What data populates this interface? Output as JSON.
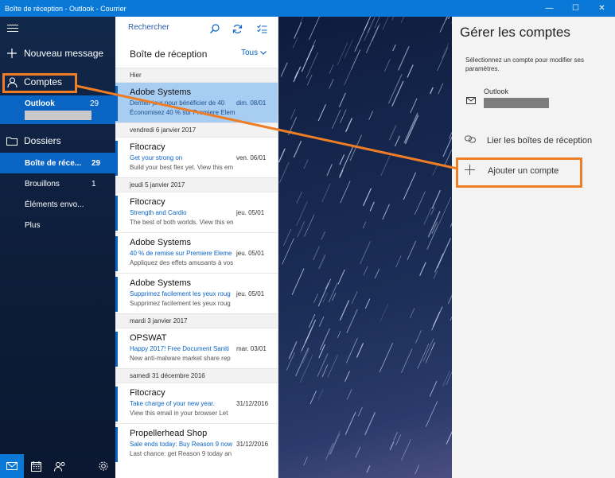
{
  "window": {
    "title": "Boîte de réception - Outlook - Courrier",
    "min": "—",
    "max": "☐",
    "close": "✕"
  },
  "nav": {
    "new_message": "Nouveau message",
    "accounts": "Comptes",
    "account": {
      "name": "Outlook",
      "count": "29"
    },
    "folders_label": "Dossiers",
    "folders": [
      {
        "name": "Boîte de réce...",
        "count": "29"
      },
      {
        "name": "Brouillons",
        "count": "1"
      },
      {
        "name": "Éléments envo...",
        "count": ""
      },
      {
        "name": "Plus",
        "count": ""
      }
    ]
  },
  "list": {
    "search_placeholder": "Rechercher",
    "title": "Boîte de réception",
    "filter": "Tous",
    "groups": [
      {
        "day": "Hier",
        "mails": [
          {
            "sender": "Adobe Systems",
            "subject": "Dernier jour pour bénéficier de 40",
            "date": "dim. 08/01",
            "preview": "Économisez 40 % sur Premiere Elem",
            "selected": true
          }
        ]
      },
      {
        "day": "vendredi 6 janvier 2017",
        "mails": [
          {
            "sender": "Fitocracy",
            "subject": "Get your strong on",
            "date": "ven. 06/01",
            "preview": "Build your best flex yet. View this em"
          }
        ]
      },
      {
        "day": "jeudi 5 janvier 2017",
        "mails": [
          {
            "sender": "Fitocracy",
            "subject": "Strength and Cardio",
            "date": "jeu. 05/01",
            "preview": "The best of both worlds. View this en"
          },
          {
            "sender": "Adobe Systems",
            "subject": "40 % de remise sur Premiere Eleme",
            "date": "jeu. 05/01",
            "preview": "Appliquez des effets amusants à vos"
          },
          {
            "sender": "Adobe Systems",
            "subject": "Supprimez facilement les yeux roug",
            "date": "jeu. 05/01",
            "preview": "Supprimez facilement les yeux roug"
          }
        ]
      },
      {
        "day": "mardi 3 janvier 2017",
        "mails": [
          {
            "sender": "OPSWAT",
            "subject": "Happy 2017! Free Document Saniti",
            "date": "mar. 03/01",
            "preview": "New anti-malware market share rep"
          }
        ]
      },
      {
        "day": "samedi 31 décembre 2016",
        "mails": [
          {
            "sender": "Fitocracy",
            "subject": "Take charge of your new year.",
            "date": "31/12/2016",
            "preview": "View this email in your browser Let"
          },
          {
            "sender": "Propellerhead Shop",
            "subject": "Sale ends today: Buy Reason 9 now",
            "date": "31/12/2016",
            "preview": "Last chance: get Reason 9 today an"
          }
        ]
      }
    ]
  },
  "panel": {
    "title": "Gérer les comptes",
    "description": "Sélectionnez un compte pour modifier ses paramètres.",
    "account_name": "Outlook",
    "link_inboxes": "Lier les boîtes de réception",
    "add_account": "Ajouter un compte"
  },
  "colors": {
    "accent": "#0a78d7",
    "highlight": "#ee7d26",
    "selected_mail": "#a8cdf3"
  }
}
